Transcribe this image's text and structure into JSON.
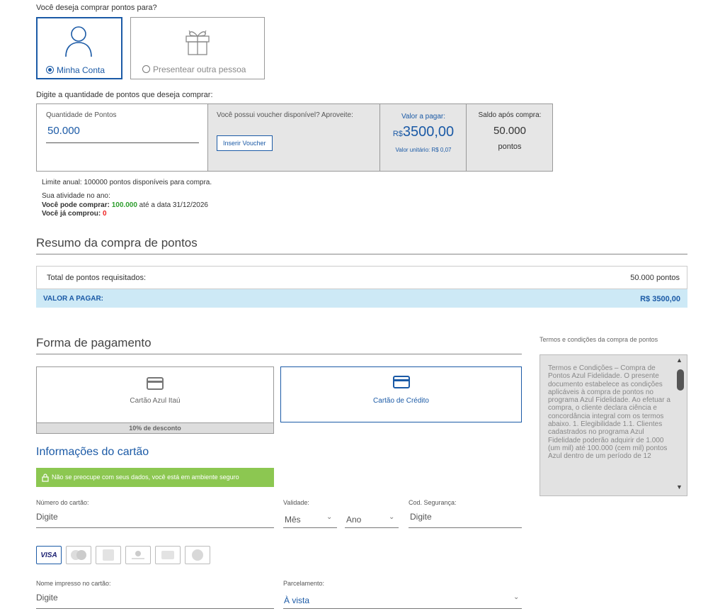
{
  "question": "Você deseja comprar pontos para?",
  "recipient_options": [
    {
      "label": "Minha Conta",
      "selected": true,
      "icon": "user-icon"
    },
    {
      "label": "Presentear outra pessoa",
      "selected": false,
      "icon": "gift-icon"
    }
  ],
  "quantity_prompt": "Digite a quantidade de pontos que deseja comprar:",
  "calculator": {
    "quantity_label": "Quantidade de Pontos",
    "quantity_value": "50.000",
    "voucher_text": "Você possui voucher disponível? Aproveite:",
    "voucher_button": "Inserir Voucher",
    "valor_label": "Valor a pagar:",
    "valor_currency": "R$",
    "valor_amount": "3500,00",
    "valor_unit": "Valor unitário: R$ 0,07",
    "saldo_label": "Saldo após compra:",
    "saldo_value": "50.000",
    "saldo_unit": "pontos"
  },
  "limits": {
    "annual": "Limite anual: 100000 pontos disponíveis para compra.",
    "activity": "Sua atividade no ano:",
    "can_buy_label": "Você pode comprar:",
    "can_buy_value": "100.000",
    "can_buy_suffix": "até a data 31/12/2026",
    "bought_label": "Você já comprou:",
    "bought_value": "0"
  },
  "summary": {
    "title": "Resumo da compra de pontos",
    "total_label": "Total de pontos requisitados:",
    "total_value": "50.000 pontos",
    "pay_label": "VALOR A PAGAR:",
    "pay_value": "R$ 3500,00"
  },
  "payment": {
    "title": "Forma de pagamento",
    "methods": [
      {
        "label": "Cartão Azul Itaú",
        "selected": false,
        "discount": "10% de desconto",
        "icon": "card-icon"
      },
      {
        "label": "Cartão de Crédito",
        "selected": true,
        "icon": "card-icon"
      }
    ]
  },
  "terms": {
    "title": "Termos e condições da compra de pontos",
    "text": "Termos e Condições – Compra de Pontos Azul Fidelidade. O presente documento estabelece as condições aplicáveis à compra de pontos no programa Azul Fidelidade. Ao efetuar a compra, o cliente declara ciência e concordância integral com os termos abaixo. 1. Elegibilidade 1.1. Clientes cadastrados no programa Azul Fidelidade poderão adquirir de 1.000 (um mil) até 100.000 (cem mil) pontos Azul dentro de um período de 12"
  },
  "card_info": {
    "title": "Informações do cartão",
    "secure_notice": "Não se preocupe com seus dados, você está em ambiente seguro",
    "number_label": "Número do cartão:",
    "number_placeholder": "Digite",
    "validity_label": "Validade:",
    "month_value": "Mês",
    "year_value": "Ano",
    "cvv_label": "Cod. Segurança:",
    "cvv_placeholder": "Digite",
    "brands": [
      "VISA",
      "mastercard",
      "amex",
      "diners",
      "hipercard",
      "elo"
    ],
    "name_label": "Nome impresso no cartão:",
    "name_placeholder": "Digite",
    "installments_label": "Parcelamento:",
    "installments_value": "À vista"
  },
  "colors": {
    "accent": "#1b5aa6",
    "success": "#2e9e2e",
    "danger": "#e22",
    "notice_bg": "#8cc751",
    "summary_bg": "#cde9f6"
  }
}
